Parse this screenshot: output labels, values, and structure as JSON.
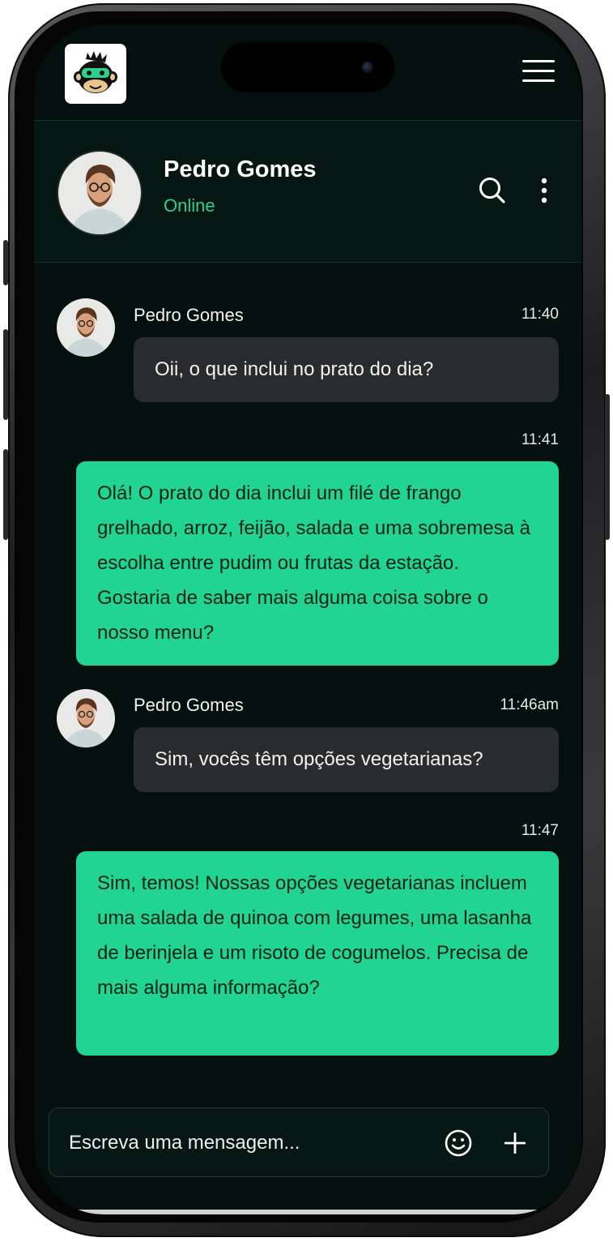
{
  "app": {
    "logo_icon": "monkey-gamer-icon",
    "menu_icon": "hamburger-menu-icon"
  },
  "contact": {
    "name": "Pedro Gomes",
    "status": "Online",
    "status_color": "#2ed08f",
    "avatar_icon": "person-avatar"
  },
  "header_actions": {
    "search_icon": "search-icon",
    "more_icon": "more-vertical-icon"
  },
  "messages": [
    {
      "direction": "incoming",
      "sender": "Pedro Gomes",
      "time": "11:40",
      "text": "Oii, o que inclui no prato do dia?"
    },
    {
      "direction": "outgoing",
      "time": "11:41",
      "text": "Olá! O prato do dia inclui um filé de frango grelhado, arroz, feijão, salada e uma sobremesa à escolha entre pudim ou frutas da estação. Gostaria de saber mais alguma coisa sobre o nosso menu?"
    },
    {
      "direction": "incoming",
      "sender": "Pedro Gomes",
      "time": "11:46am",
      "text": "Sim, vocês têm opções vegetarianas?"
    },
    {
      "direction": "outgoing",
      "time": "11:47",
      "text": "Sim, temos! Nossas opções vegetarianas incluem uma salada de quinoa com legumes, uma lasanha de berinjela e um risoto de cogumelos. Precisa de mais alguma informação?"
    }
  ],
  "composer": {
    "placeholder": "Escreva uma mensagem...",
    "value": "",
    "emoji_icon": "smiley-icon",
    "attach_icon": "plus-icon"
  },
  "colors": {
    "background": "#03100e",
    "outgoing_bubble": "#22d492",
    "incoming_bubble": "#2a2b2d",
    "accent": "#2ed08f"
  }
}
